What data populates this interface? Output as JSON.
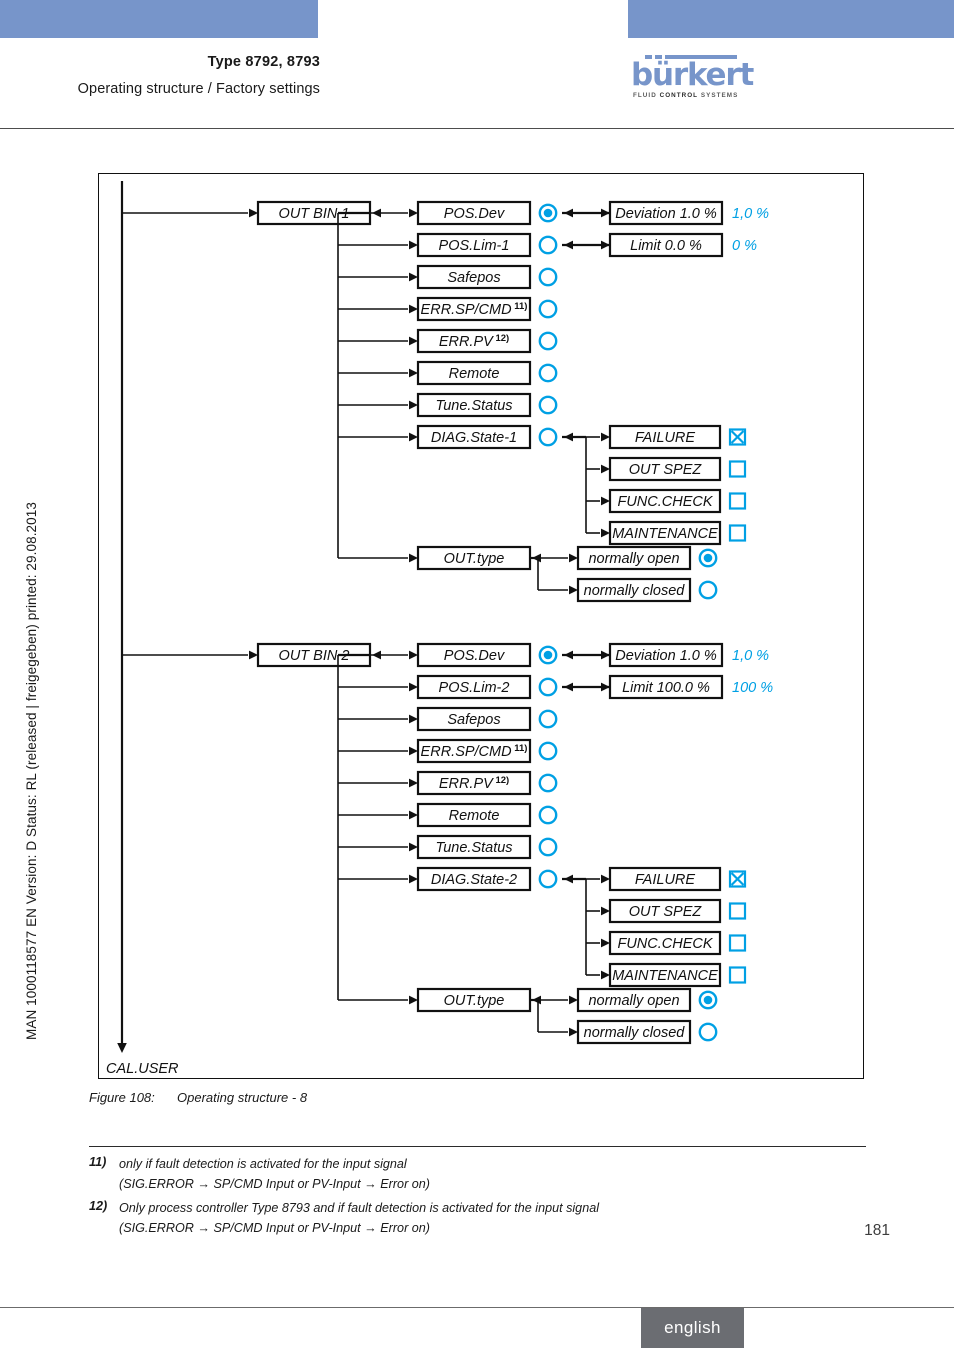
{
  "header": {
    "type_line": "Type 8792, 8793",
    "subtitle": "Operating structure / Factory settings",
    "logo_word": "bürkert",
    "logo_tagline_a": "FLUID ",
    "logo_tagline_b": "CONTROL",
    "logo_tagline_c": " SYSTEMS",
    "accent_blue": "#7795ca"
  },
  "sidebar": {
    "vertical_text": "MAN 1000118577  EN  Version: D  Status: RL (released | freigegeben)  printed: 29.08.2013"
  },
  "figure": {
    "caption_number": "Figure 108:",
    "caption_text": "Operating structure - 8",
    "trunk_end_label": "CAL.USER",
    "symbol_blue": "#00a0e4"
  },
  "diagram": {
    "groups": [
      {
        "root_label": "OUT BIN 1",
        "rows": [
          {
            "label": "POS.Dev",
            "sup": "",
            "radio": "filled",
            "value_box": "Deviation   1.0 %",
            "factory": "1,0 %"
          },
          {
            "label": "POS.Lim-1",
            "sup": "",
            "radio": "empty",
            "value_box": "Limit       0.0 %",
            "factory": "0 %"
          },
          {
            "label": "Safepos",
            "sup": "",
            "radio": "empty",
            "value_box": "",
            "factory": ""
          },
          {
            "label": "ERR.SP/CMD",
            "sup": "11)",
            "radio": "empty",
            "value_box": "",
            "factory": ""
          },
          {
            "label": "ERR.PV",
            "sup": "12)",
            "radio": "empty",
            "value_box": "",
            "factory": ""
          },
          {
            "label": "Remote",
            "sup": "",
            "radio": "empty",
            "value_box": "",
            "factory": ""
          },
          {
            "label": "Tune.Status",
            "sup": "",
            "radio": "empty",
            "value_box": "",
            "factory": ""
          },
          {
            "label": "DIAG.State-1",
            "sup": "",
            "radio": "empty",
            "value_box": "",
            "factory": ""
          }
        ],
        "diag_options": [
          {
            "label": "FAILURE",
            "checkbox": "checked"
          },
          {
            "label": "OUT SPEZ",
            "checkbox": "empty"
          },
          {
            "label": "FUNC.CHECK",
            "checkbox": "empty"
          },
          {
            "label": "MAINTENANCE",
            "checkbox": "empty"
          }
        ],
        "out_type_label": "OUT.type",
        "out_type_options": [
          {
            "label": "normally open",
            "radio": "filled"
          },
          {
            "label": "normally closed",
            "radio": "empty"
          }
        ]
      },
      {
        "root_label": "OUT BIN 2",
        "rows": [
          {
            "label": "POS.Dev",
            "sup": "",
            "radio": "filled",
            "value_box": "Deviation   1.0 %",
            "factory": "1,0 %"
          },
          {
            "label": "POS.Lim-2",
            "sup": "",
            "radio": "empty",
            "value_box": "Limit     100.0 %",
            "factory": "100 %"
          },
          {
            "label": "Safepos",
            "sup": "",
            "radio": "empty",
            "value_box": "",
            "factory": ""
          },
          {
            "label": "ERR.SP/CMD",
            "sup": "11)",
            "radio": "empty",
            "value_box": "",
            "factory": ""
          },
          {
            "label": "ERR.PV",
            "sup": "12)",
            "radio": "empty",
            "value_box": "",
            "factory": ""
          },
          {
            "label": "Remote",
            "sup": "",
            "radio": "empty",
            "value_box": "",
            "factory": ""
          },
          {
            "label": "Tune.Status",
            "sup": "",
            "radio": "empty",
            "value_box": "",
            "factory": ""
          },
          {
            "label": "DIAG.State-2",
            "sup": "",
            "radio": "empty",
            "value_box": "",
            "factory": ""
          }
        ],
        "diag_options": [
          {
            "label": "FAILURE",
            "checkbox": "checked"
          },
          {
            "label": "OUT SPEZ",
            "checkbox": "empty"
          },
          {
            "label": "FUNC.CHECK",
            "checkbox": "empty"
          },
          {
            "label": "MAINTENANCE",
            "checkbox": "empty"
          }
        ],
        "out_type_label": "OUT.type",
        "out_type_options": [
          {
            "label": "normally open",
            "radio": "filled"
          },
          {
            "label": "normally closed",
            "radio": "empty"
          }
        ]
      }
    ]
  },
  "footnotes": [
    {
      "marker": "11)",
      "line1": "only if fault detection is activated for the input signal",
      "line2": "(SIG.ERROR → SP/CMD Input or PV-Input → Error on)"
    },
    {
      "marker": "12)",
      "line1": "Only process controller Type 8793 and if fault detection is activated for the input signal",
      "line2": "(SIG.ERROR → SP/CMD Input or PV-Input → Error on)"
    }
  ],
  "footer": {
    "page_number": "181",
    "language": "english"
  }
}
